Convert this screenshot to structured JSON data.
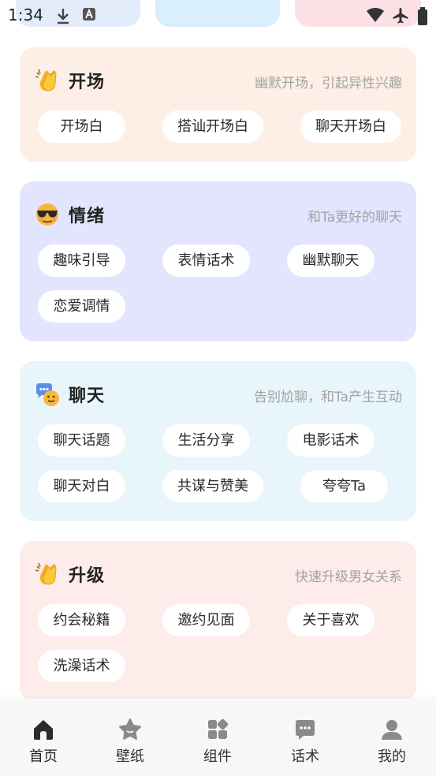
{
  "status_bar": {
    "time": "1:34",
    "icons": [
      "download-icon",
      "app-badge-icon",
      "wifi-icon",
      "airplane-icon",
      "battery-icon"
    ]
  },
  "sections": [
    {
      "title": "开场",
      "subtitle": "幽默开场，引起异性兴趣",
      "icon": "clapping-hands-icon",
      "bg_color": "#fdefe5",
      "tags": [
        "开场白",
        "搭讪开场白",
        "聊天开场白"
      ]
    },
    {
      "title": "情绪",
      "subtitle": "和Ta更好的聊天",
      "icon": "sunglasses-face-icon",
      "bg_color": "#e2e5fd",
      "tags": [
        "趣味引导",
        "表情话术",
        "幽默聊天",
        "恋爱调情"
      ]
    },
    {
      "title": "聊天",
      "subtitle": "告别尬聊，和Ta产生互动",
      "icon": "chat-bubbles-icon",
      "bg_color": "#e8f5fb",
      "tags": [
        "聊天话题",
        "生活分享",
        "电影话术",
        "聊天对白",
        "共谋与赞美",
        "夸夸Ta"
      ]
    },
    {
      "title": "升级",
      "subtitle": "快速升级男女关系",
      "icon": "clapping-hands-icon",
      "bg_color": "#fdecea",
      "tags": [
        "约会秘籍",
        "邀约见面",
        "关于喜欢",
        "洗澡话术"
      ]
    }
  ],
  "bottom_nav": [
    {
      "label": "首页",
      "icon": "home-icon",
      "active": true
    },
    {
      "label": "壁纸",
      "icon": "star-icon",
      "active": false
    },
    {
      "label": "组件",
      "icon": "widgets-icon",
      "active": false
    },
    {
      "label": "话术",
      "icon": "chat-icon",
      "active": false
    },
    {
      "label": "我的",
      "icon": "profile-icon",
      "active": false
    }
  ]
}
